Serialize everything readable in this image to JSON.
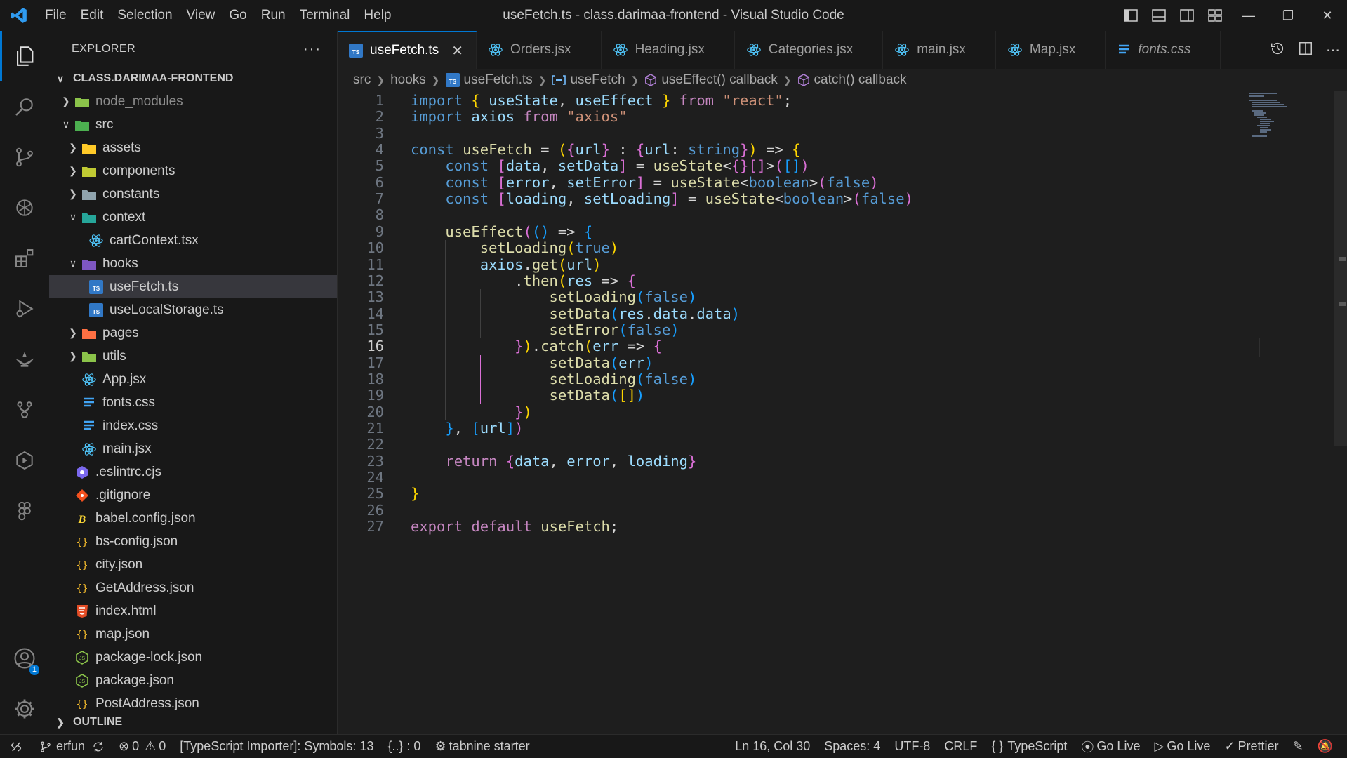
{
  "titlebar": {
    "menu": [
      "File",
      "Edit",
      "Selection",
      "View",
      "Go",
      "Run",
      "Terminal",
      "Help"
    ],
    "title": "useFetch.ts - class.darimaa-frontend - Visual Studio Code"
  },
  "activity_bar": {
    "items": [
      "explorer-icon",
      "search-icon",
      "source-control-icon",
      "openai-icon",
      "extensions-icon",
      "run-debug-icon",
      "lamp-icon",
      "git-graph-icon",
      "live-share-icon",
      "figma-icon"
    ],
    "accounts_badge": "1"
  },
  "sidebar": {
    "header": "EXPLORER",
    "more": "···",
    "project": "CLASS.DARIMAA-FRONTEND",
    "tree": [
      {
        "label": "node_modules",
        "depth": 1,
        "chevron": "right",
        "icon": "folder-node",
        "dim": true
      },
      {
        "label": "src",
        "depth": 1,
        "chevron": "down",
        "icon": "folder-src"
      },
      {
        "label": "assets",
        "depth": 2,
        "chevron": "right",
        "icon": "folder-assets"
      },
      {
        "label": "components",
        "depth": 2,
        "chevron": "right",
        "icon": "folder-components"
      },
      {
        "label": "constants",
        "depth": 2,
        "chevron": "right",
        "icon": "folder-constants"
      },
      {
        "label": "context",
        "depth": 2,
        "chevron": "down",
        "icon": "folder-context"
      },
      {
        "label": "cartContext.tsx",
        "depth": 3,
        "chevron": "",
        "icon": "react"
      },
      {
        "label": "hooks",
        "depth": 2,
        "chevron": "down",
        "icon": "folder-hooks"
      },
      {
        "label": "useFetch.ts",
        "depth": 3,
        "chevron": "",
        "icon": "ts",
        "selected": true
      },
      {
        "label": "useLocalStorage.ts",
        "depth": 3,
        "chevron": "",
        "icon": "ts"
      },
      {
        "label": "pages",
        "depth": 2,
        "chevron": "right",
        "icon": "folder-pages"
      },
      {
        "label": "utils",
        "depth": 2,
        "chevron": "right",
        "icon": "folder-utils"
      },
      {
        "label": "App.jsx",
        "depth": 2,
        "chevron": "",
        "icon": "react"
      },
      {
        "label": "fonts.css",
        "depth": 2,
        "chevron": "",
        "icon": "css"
      },
      {
        "label": "index.css",
        "depth": 2,
        "chevron": "",
        "icon": "css"
      },
      {
        "label": "main.jsx",
        "depth": 2,
        "chevron": "",
        "icon": "react"
      },
      {
        "label": ".eslintrc.cjs",
        "depth": 1,
        "chevron": "",
        "icon": "eslint"
      },
      {
        "label": ".gitignore",
        "depth": 1,
        "chevron": "",
        "icon": "git"
      },
      {
        "label": "babel.config.json",
        "depth": 1,
        "chevron": "",
        "icon": "babel"
      },
      {
        "label": "bs-config.json",
        "depth": 1,
        "chevron": "",
        "icon": "json"
      },
      {
        "label": "city.json",
        "depth": 1,
        "chevron": "",
        "icon": "json"
      },
      {
        "label": "GetAddress.json",
        "depth": 1,
        "chevron": "",
        "icon": "json"
      },
      {
        "label": "index.html",
        "depth": 1,
        "chevron": "",
        "icon": "html"
      },
      {
        "label": "map.json",
        "depth": 1,
        "chevron": "",
        "icon": "json"
      },
      {
        "label": "package-lock.json",
        "depth": 1,
        "chevron": "",
        "icon": "node"
      },
      {
        "label": "package.json",
        "depth": 1,
        "chevron": "",
        "icon": "node"
      },
      {
        "label": "PostAddress.json",
        "depth": 1,
        "chevron": "",
        "icon": "json"
      }
    ],
    "outline": "OUTLINE"
  },
  "tabs": [
    {
      "label": "useFetch.ts",
      "icon": "ts",
      "active": true
    },
    {
      "label": "Orders.jsx",
      "icon": "react"
    },
    {
      "label": "Heading.jsx",
      "icon": "react"
    },
    {
      "label": "Categories.jsx",
      "icon": "react"
    },
    {
      "label": "main.jsx",
      "icon": "react"
    },
    {
      "label": "Map.jsx",
      "icon": "react"
    },
    {
      "label": "fonts.css",
      "icon": "css",
      "italic": true
    }
  ],
  "breadcrumb": [
    "src",
    "hooks",
    "useFetch.ts",
    "useFetch",
    "useEffect() callback",
    "catch() callback"
  ],
  "editor": {
    "current_line": 16,
    "lines": [
      "import { useState, useEffect } from \"react\";",
      "import axios from \"axios\"",
      "",
      "const useFetch = ({url} : {url: string}) => {",
      "    const [data, setData] = useState<{}[]>([])",
      "    const [error, setError] = useState<boolean>(false)",
      "    const [loading, setLoading] = useState<boolean>(false)",
      "",
      "    useEffect(() => {",
      "        setLoading(true)",
      "        axios.get(url)",
      "            .then(res => {",
      "                setLoading(false)",
      "                setData(res.data.data)",
      "                setError(false)",
      "            }).catch(err => {",
      "                setData(err)",
      "                setLoading(false)",
      "                setData([])",
      "            })",
      "    }, [url])",
      "",
      "    return {data, error, loading}",
      "",
      "}",
      "",
      "export default useFetch;"
    ]
  },
  "statusbar": {
    "branch": "erfun",
    "problems": "0",
    "warnings": "0",
    "ts_importer": "[TypeScript Importer]: Symbols: 13",
    "braces": "{..} : 0",
    "tabnine": "tabnine starter",
    "position": "Ln 16, Col 30",
    "spaces": "Spaces: 4",
    "encoding": "UTF-8",
    "eol": "CRLF",
    "language": "TypeScript",
    "golive1": "Go Live",
    "golive2": "Go Live",
    "prettier": "Prettier"
  }
}
